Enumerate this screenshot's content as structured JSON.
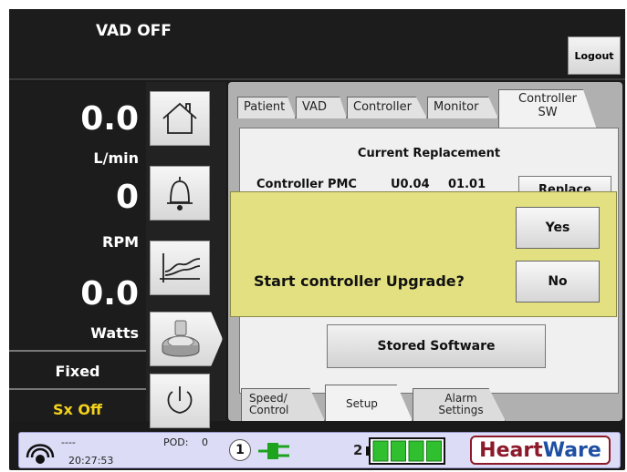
{
  "header": {
    "vad_status": "VAD OFF",
    "logout_label": "Logout"
  },
  "readouts": {
    "flow_value": "0.0",
    "flow_unit": "L/min",
    "speed_value": "0",
    "speed_unit": "RPM",
    "power_value": "0.0",
    "power_unit": "Watts",
    "mode": "Fixed",
    "sx_status": "Sx Off"
  },
  "nav": [
    {
      "name": "home-icon"
    },
    {
      "name": "bell-icon"
    },
    {
      "name": "trend-graph-icon"
    },
    {
      "name": "pump-icon"
    },
    {
      "name": "power-icon"
    }
  ],
  "tabs": {
    "patient": "Patient",
    "vad": "VAD",
    "controller": "Controller",
    "monitor": "Monitor",
    "controller_sw_line1": "Controller",
    "controller_sw_line2": "SW"
  },
  "content": {
    "current_replacement": "Current Replacement",
    "controller_label": "Controller PMC",
    "version_1": "U0.04",
    "version_2": "01.01",
    "replace_label": "Replace",
    "stored_software_label": "Stored Software"
  },
  "dialog": {
    "message": "Start controller Upgrade?",
    "yes_label": "Yes",
    "no_label": "No"
  },
  "bottom_tabs": {
    "speed_line1": "Speed/",
    "speed_line2": "Control",
    "setup": "Setup",
    "alarm_line1": "Alarm",
    "alarm_line2": "Settings"
  },
  "statusbar": {
    "signal_text": "----",
    "time": "20:27:53",
    "pod_label": "POD:",
    "pod_value": "0",
    "power1_number": "1",
    "power2_number": "2",
    "battery_level_fraction": 1.0,
    "logo_heart": "Heart",
    "logo_ware": "Ware"
  },
  "colors": {
    "sx_status": "#f4d21c",
    "dialog_bg": "#e3e081",
    "statusbar_bg": "#dcdcf6",
    "battery_green": "#2fbf2f",
    "plug_green": "#1ea31e",
    "logo_red": "#8c1a2a",
    "logo_blue": "#1f4fa3"
  }
}
